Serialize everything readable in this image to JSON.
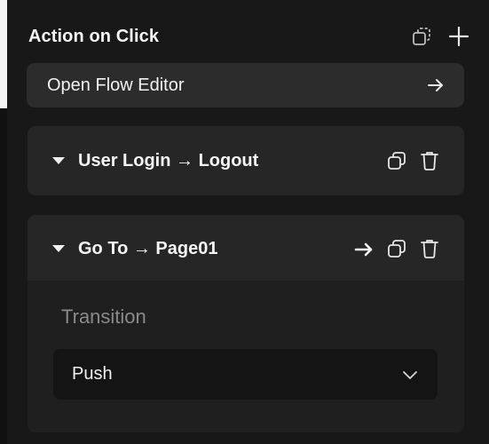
{
  "header": {
    "title": "Action on Click"
  },
  "flow_editor": {
    "label": "Open Flow Editor"
  },
  "actions": [
    {
      "title": "User Login → Logout",
      "expanded": false
    },
    {
      "title": "Go To → Page01",
      "expanded": true,
      "transition": {
        "label": "Transition",
        "value": "Push"
      }
    }
  ],
  "icons": {
    "header": [
      "duplicate-icon",
      "plus-icon"
    ],
    "flow_editor": "arrow-right-icon",
    "card": [
      "caret-down-icon",
      "copy-icon",
      "trash-icon"
    ],
    "navigate": "arrow-right-icon",
    "select": "chevron-down-icon"
  },
  "colors": {
    "background": "#181818",
    "card": "#262626",
    "button": "#2c2c2c",
    "muted_text": "#8a8a8a"
  }
}
